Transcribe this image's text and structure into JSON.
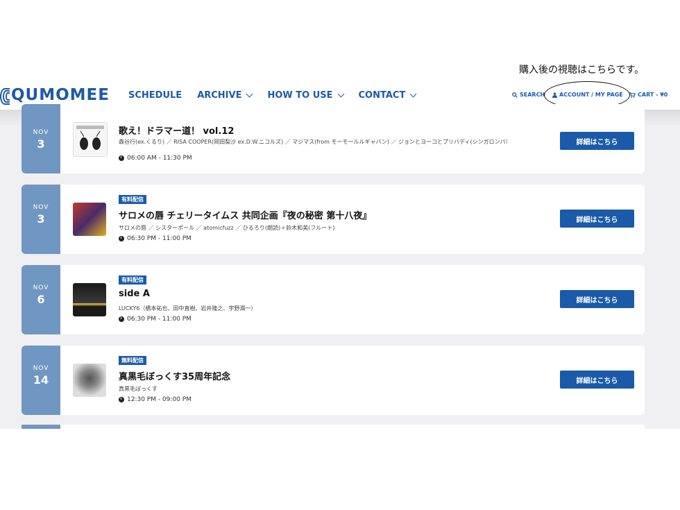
{
  "annotation": "購入後の視聴はこちらです。",
  "logo": "QUMOMEE",
  "nav": [
    {
      "label": "SCHEDULE"
    },
    {
      "label": "ARCHIVE"
    },
    {
      "label": "HOW TO USE"
    },
    {
      "label": "CONTACT"
    }
  ],
  "utility": {
    "search": "SEARCH",
    "account": "ACCOUNT / MY PAGE",
    "cart": "CART - ¥0"
  },
  "events": [
    {
      "month": "NOV",
      "day": "3",
      "badge": "",
      "title": "歌え！ドラマー道！ vol.12",
      "artists": "森谷行(ex.くるり) ／ RISA COOPER(岡田梨沙 ex.D.W.ニコルズ) ／ マジマス(from モーモールルギャバン) ／ ジョンとヨーコとプリバディ(シンガロンパレード) ／ 澤本泰平(LOVE LOVE LOVE) ／ 深田和良(モルグモルマルモ)",
      "time": "06:00 AM - 11:30 PM",
      "button": "詳細はこちら"
    },
    {
      "month": "NOV",
      "day": "3",
      "badge": "有料配信",
      "title": "サロメの唇 チェリータイムス 共同企画『夜の秘密 第十八夜』",
      "artists": "サロメの唇 ／ シスターポール ／ atomicfuzz ／ ひるろり(朗読)＋鈴木和美(フルート)",
      "time": "06:30 PM - 11:00 PM",
      "button": "詳細はこちら"
    },
    {
      "month": "NOV",
      "day": "6",
      "badge": "有料配信",
      "title": "side A",
      "artists": "LUCKY6（橋本祐也、田中直樹、岩井隆之、宇野潤一）",
      "time": "06:30 PM - 11:00 PM",
      "button": "詳細はこちら"
    },
    {
      "month": "NOV",
      "day": "14",
      "badge": "無料配信",
      "title": "真黒毛ぼっくす35周年記念",
      "artists": "真黒毛ぼっくす",
      "time": "12:30 PM - 09:00 PM",
      "button": "詳細はこちら"
    }
  ]
}
